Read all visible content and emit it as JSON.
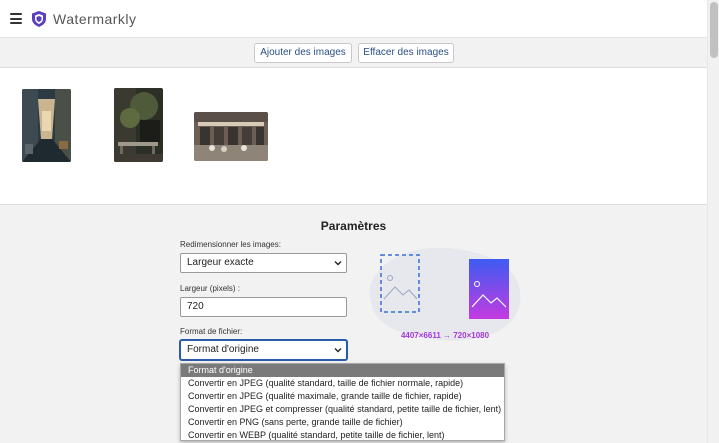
{
  "app": {
    "title": "Watermarkly"
  },
  "toolbar": {
    "add_label": "Ajouter des images",
    "clear_label": "Effacer des images"
  },
  "settings": {
    "title": "Paramètres",
    "resize_label": "Redimensionner les images:",
    "resize_value": "Largeur exacte",
    "width_label": "Largeur (pixels) :",
    "width_value": "720",
    "format_label": "Format de fichier:",
    "format_value": "Format d'origine",
    "dimensions_text": "4407×6611 → 720×1080"
  },
  "format_options": [
    "Format d'origine",
    "Convertir en JPEG (qualité standard, taille de fichier normale, rapide)",
    "Convertir en JPEG (qualité maximale, grande taille de fichier, rapide)",
    "Convertir en JPEG et compresser (qualité standard, petite taille de fichier, lent)",
    "Convertir en PNG (sans perte, grande taille de fichier)",
    "Convertir en WEBP (qualité standard, petite taille de fichier, lent)"
  ],
  "colors": {
    "accent": "#2a4f86",
    "logo": "#5b3fbf",
    "preview_gradient_top": "#3d5cf2",
    "preview_gradient_bottom": "#c43ae0",
    "dims_text": "#a33ad8"
  },
  "icons": {
    "menu": "hamburger-menu-icon",
    "logo": "shield-logo-icon",
    "chevron": "chevron-down-icon"
  }
}
